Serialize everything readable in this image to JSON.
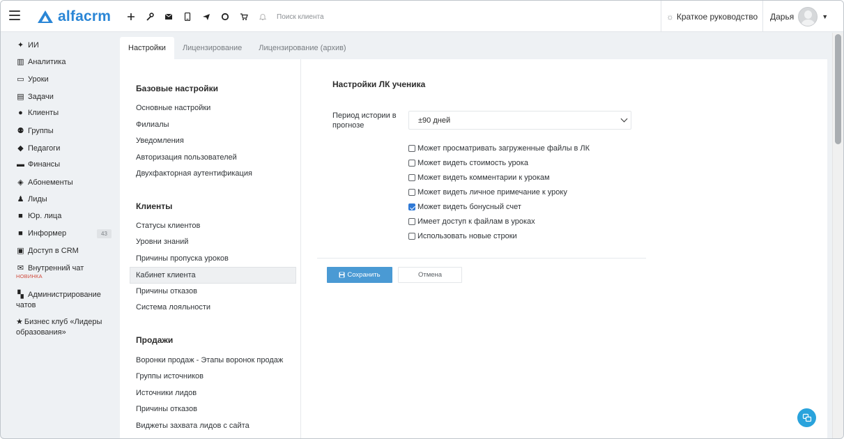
{
  "header": {
    "logo_text": "alfacrm",
    "search_placeholder": "Поиск клиента",
    "guide_label": "Краткое руководство",
    "user_name": "Дарья"
  },
  "sidebar": {
    "items": [
      {
        "label": "ИИ",
        "icon": "sparkle-icon"
      },
      {
        "label": "Аналитика",
        "icon": "analytics-icon"
      },
      {
        "label": "Уроки",
        "icon": "calendar-icon"
      },
      {
        "label": "Задачи",
        "icon": "tasks-icon"
      },
      {
        "label": "Клиенты",
        "icon": "user-icon"
      },
      {
        "label": "Группы",
        "icon": "group-icon"
      },
      {
        "label": "Педагоги",
        "icon": "graduation-cap-icon"
      },
      {
        "label": "Финансы",
        "icon": "money-icon"
      },
      {
        "label": "Абонементы",
        "icon": "tag-icon"
      },
      {
        "label": "Лиды",
        "icon": "lead-icon"
      },
      {
        "label": "Юр. лица",
        "icon": "briefcase-icon"
      },
      {
        "label": "Информер",
        "icon": "informer-icon",
        "badge": "43"
      },
      {
        "label": "Доступ в CRM",
        "icon": "lock-icon"
      },
      {
        "label": "Внутренний чат",
        "icon": "envelope-icon",
        "badge": "НОВИНКА"
      },
      {
        "label": "Администрирование чатов",
        "icon": "chat-admin-icon"
      },
      {
        "label": "Бизнес клуб «Лидеры образования»",
        "icon": "star-icon"
      }
    ]
  },
  "tabs": [
    {
      "label": "Настройки",
      "active": true
    },
    {
      "label": "Лицензирование",
      "active": false
    },
    {
      "label": "Лицензирование (архив)",
      "active": false
    }
  ],
  "settings_nav": {
    "sections": [
      {
        "title": "Базовые настройки",
        "links": [
          "Основные настройки",
          "Филиалы",
          "Уведомления",
          "Авторизация пользователей",
          "Двухфакторная аутентификация"
        ]
      },
      {
        "title": "Клиенты",
        "links": [
          "Статусы клиентов",
          "Уровни знаний",
          "Причины пропуска уроков",
          "Кабинет клиента",
          "Причины отказов",
          "Система лояльности"
        ]
      },
      {
        "title": "Продажи",
        "links": [
          "Воронки продаж - Этапы воронок продаж",
          "Группы источников",
          "Источники лидов",
          "Причины отказов",
          "Виджеты захвата лидов с сайта"
        ]
      }
    ],
    "active_link": "Кабинет клиента"
  },
  "form": {
    "title": "Настройки ЛК ученика",
    "period_label": "Период истории в прогнозе",
    "period_value": "±90 дней",
    "checkboxes": [
      {
        "label": "Может просматривать загруженные файлы в ЛК",
        "checked": false
      },
      {
        "label": "Может видеть стоимость урока",
        "checked": false
      },
      {
        "label": "Может видеть комментарии к урокам",
        "checked": false
      },
      {
        "label": "Может видеть личное примечание к уроку",
        "checked": false
      },
      {
        "label": "Может видеть бонусный счет",
        "checked": true
      },
      {
        "label": "Имеет доступ к файлам в уроках",
        "checked": false
      },
      {
        "label": "Использовать новые строки",
        "checked": false
      }
    ],
    "save_label": "Сохранить",
    "cancel_label": "Отмена"
  },
  "colors": {
    "brand": "#2a86d6",
    "save_button": "#4a9ad4",
    "fab": "#2aa3dc",
    "new_badge": "#d04a3c"
  }
}
